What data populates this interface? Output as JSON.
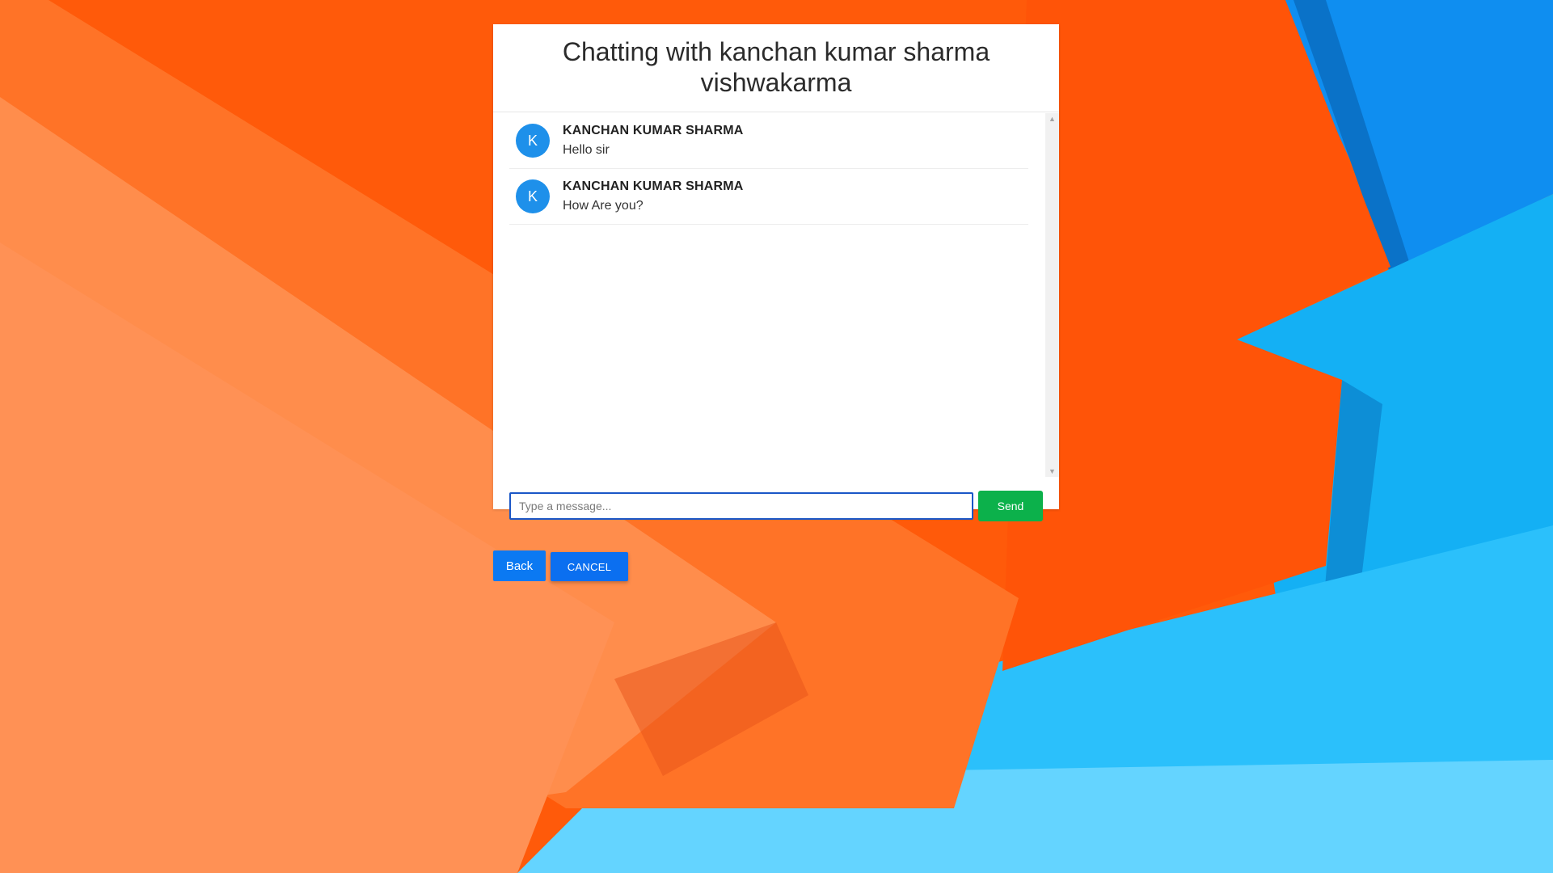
{
  "chat": {
    "title": "Chatting with kanchan kumar sharma vishwakarma",
    "messages": [
      {
        "avatar_letter": "K",
        "sender": "KANCHAN KUMAR SHARMA",
        "text": "Hello sir"
      },
      {
        "avatar_letter": "K",
        "sender": "KANCHAN KUMAR SHARMA",
        "text": "How Are you?"
      }
    ]
  },
  "composer": {
    "placeholder": "Type a message...",
    "value": "",
    "send_label": "Send"
  },
  "actions": {
    "back_label": "Back",
    "cancel_label": "CANCEL"
  },
  "colors": {
    "avatar": "#1e90ea",
    "send_button": "#0cb14b",
    "primary_button": "#0b79f2",
    "input_border": "#1a57c7"
  },
  "icons": {
    "scroll_up": "scroll-up-arrow-icon",
    "scroll_down": "scroll-down-arrow-icon"
  }
}
